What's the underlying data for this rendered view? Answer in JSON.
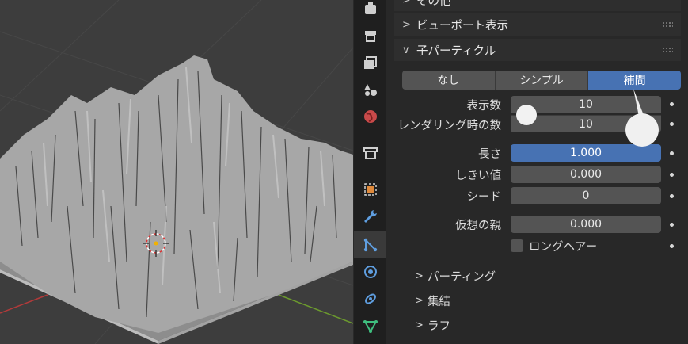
{
  "properties": {
    "top_cut_label": "その他",
    "viewport_display_panel": "ビューポート表示",
    "children_panel": "子パーティクル",
    "child_type": {
      "options": [
        "なし",
        "シンプル",
        "補間"
      ],
      "selected": "補間"
    },
    "fields": {
      "display_amount": {
        "label": "表示数",
        "value": "10"
      },
      "render_amount": {
        "label": "レンダリング時の数",
        "value": "10"
      },
      "length": {
        "label": "長さ",
        "value": "1.000"
      },
      "threshold": {
        "label": "しきい値",
        "value": "0.000"
      },
      "seed": {
        "label": "シード",
        "value": "0"
      },
      "virtual_parents": {
        "label": "仮想の親",
        "value": "0.000"
      }
    },
    "long_hair": {
      "label": "ロングヘアー",
      "checked": false
    },
    "subpanels": [
      "パーティング",
      "集結",
      "ラフ"
    ]
  },
  "colors": {
    "accent": "#4772b3",
    "panel_bg": "#282828",
    "field_bg": "#545454",
    "viewport_bg": "#3d3d3d"
  },
  "tab_icons": [
    "tool-icon",
    "render-icon",
    "output-icon",
    "view-layer-icon",
    "scene-icon",
    "world-icon",
    "collection-icon",
    "object-icon",
    "modifier-icon",
    "particles-icon",
    "physics-icon",
    "constraints-icon",
    "data-icon"
  ]
}
